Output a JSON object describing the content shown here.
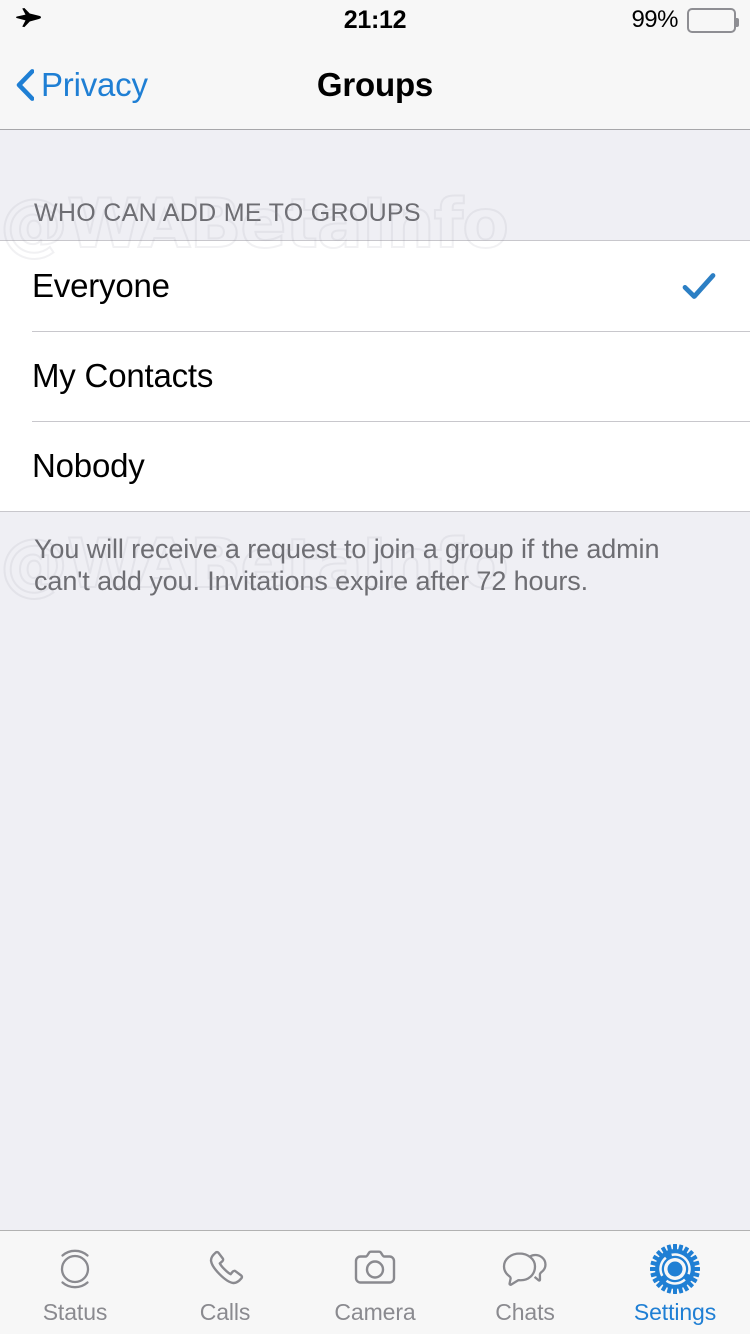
{
  "status_bar": {
    "airplane_icon": "airplane-mode-icon",
    "time": "21:12",
    "battery_percent": "99%",
    "battery_level": 97,
    "battery_icon": "battery-full-icon"
  },
  "nav_bar": {
    "back_icon": "chevron-left-icon",
    "back_label": "Privacy",
    "title": "Groups",
    "accent_color": "#1f7fd4"
  },
  "main": {
    "section_header": "WHO CAN ADD ME TO GROUPS",
    "options": [
      {
        "label": "Everyone",
        "selected": true
      },
      {
        "label": "My Contacts",
        "selected": false
      },
      {
        "label": "Nobody",
        "selected": false
      }
    ],
    "check_icon": "checkmark-icon",
    "check_color": "#2c7fc4",
    "footer_note": "You will receive a request to join a group if the admin can't add you. Invitations expire after 72 hours."
  },
  "watermark": {
    "text": "@WABetaInfo"
  },
  "tab_bar": {
    "tabs": [
      {
        "label": "Status",
        "icon": "status-rings-icon",
        "active": false
      },
      {
        "label": "Calls",
        "icon": "phone-handset-icon",
        "active": false
      },
      {
        "label": "Camera",
        "icon": "camera-icon",
        "active": false
      },
      {
        "label": "Chats",
        "icon": "chat-bubbles-icon",
        "active": false
      },
      {
        "label": "Settings",
        "icon": "gear-icon",
        "active": true
      }
    ],
    "inactive_color": "#8a8a8f",
    "active_color": "#1f7fd4"
  }
}
